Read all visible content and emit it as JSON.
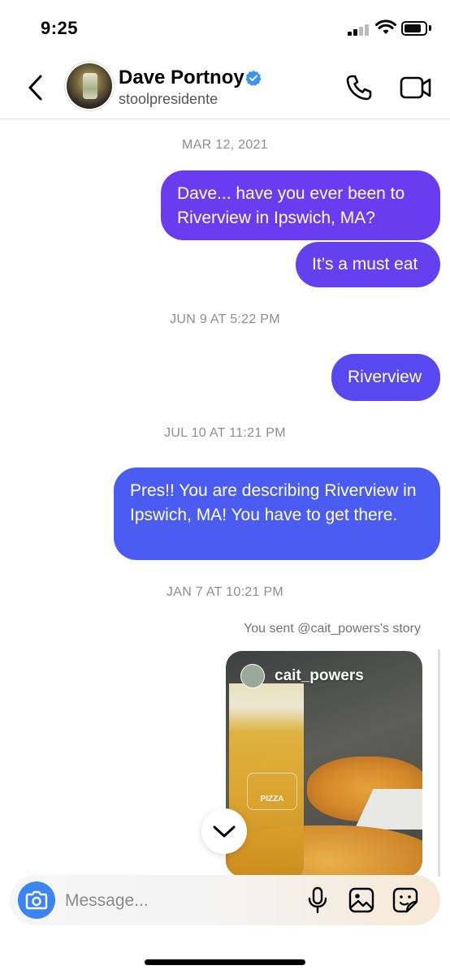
{
  "status_bar": {
    "time": "9:25"
  },
  "header": {
    "name": "Dave Portnoy",
    "handle": "stoolpresidente",
    "verified": true
  },
  "messages": [
    {
      "type": "timestamp",
      "text": "MAR 12, 2021"
    },
    {
      "type": "sent",
      "text": "Dave... have you ever been to Riverview in Ipswich, MA?"
    },
    {
      "type": "sent",
      "text": "It’s a must eat"
    },
    {
      "type": "timestamp",
      "text": "JUN 9 AT 5:22 PM"
    },
    {
      "type": "sent",
      "text": "Riverview"
    },
    {
      "type": "timestamp",
      "text": "JUL 10 AT 11:21 PM"
    },
    {
      "type": "sent",
      "text": "Pres!! You are describing Riverview in Ipswich, MA! You have to get there."
    },
    {
      "type": "timestamp",
      "text": "JAN 7 AT 10:21 PM"
    }
  ],
  "story": {
    "caption": "You sent @cait_powers's story",
    "username": "cait_powers",
    "logo_text": "PIZZA"
  },
  "composer": {
    "placeholder": "Message..."
  },
  "colors": {
    "bubble_1": "#6a3cf0",
    "bubble_2": "#6440f0",
    "bubble_3": "#5848f0",
    "bubble_4": "#4a5cf2",
    "camera": "#3a85f3",
    "verified": "#3a95f0"
  },
  "icons": [
    "back-chevron-icon",
    "verified-badge-icon",
    "phone-icon",
    "video-camera-icon",
    "camera-icon",
    "microphone-icon",
    "gallery-icon",
    "sticker-icon",
    "chevron-down-icon"
  ]
}
